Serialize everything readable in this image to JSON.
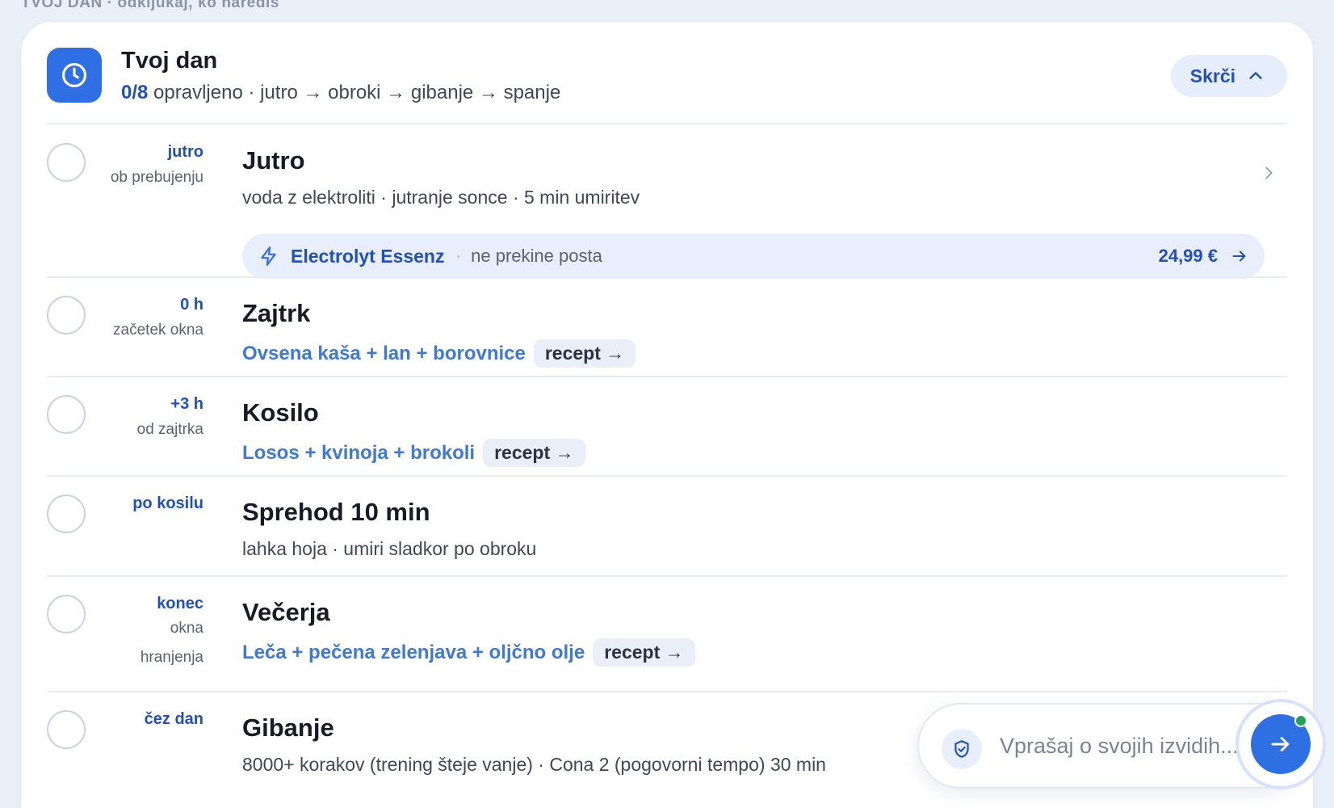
{
  "caption": "TVOJ DAN · odkljukaj, ko narediš",
  "header": {
    "title": "Tvoj dan",
    "progress_count": "0/8",
    "progress_rest": " opravljeno · jutro → obroki → gibanje → spanje",
    "collapse_label": "Skrči"
  },
  "items": [
    {
      "when_key": "jutro",
      "when_sub": "ob prebujenju",
      "title": "Jutro",
      "desc": "voda z elektroliti · jutranje sonce · 5 min umiritev",
      "product": {
        "name": "Electrolyt Essenz",
        "separator": "·",
        "tag": "ne prekine posta",
        "price": "24,99 €"
      }
    },
    {
      "when_key": "0 h",
      "when_sub": "začetek okna",
      "title": "Zajtrk",
      "meal": "Ovsena kaša + lan + borovnice",
      "recipe": "recept →"
    },
    {
      "when_key": "+3 h",
      "when_sub": "od zajtrka",
      "title": "Kosilo",
      "meal": "Losos + kvinoja + brokoli",
      "recipe": "recept →"
    },
    {
      "when_key": "po kosilu",
      "title": "Sprehod 10 min",
      "desc": "lahka hoja · umiri sladkor po obroku"
    },
    {
      "when_key": "konec",
      "when_sub_lines": [
        "okna",
        "hranjenja"
      ],
      "title": "Večerja",
      "meal": "Leča + pečena zelenjava + oljčno olje",
      "recipe": "recept →"
    },
    {
      "when_key": "čez dan",
      "title": "Gibanje",
      "desc": "8000+ korakov (trening šteje vanje) · Cona 2 (pogovorni tempo) 30 min"
    }
  ],
  "chat": {
    "placeholder": "Vprašaj o svojih izvidih..."
  },
  "colors": {
    "accent": "#2f6fe4",
    "accent_text": "#2150b8",
    "meal_link": "#3e78d8",
    "status_dot": "#21a35a"
  },
  "icons": {
    "header": "clock-icon",
    "collapse": "chevron-up-icon",
    "row_open": "chevron-right-icon",
    "product": "lightning-icon",
    "product_link": "arrow-right-icon",
    "chat": "shield-check-icon",
    "send": "arrow-right-icon"
  }
}
